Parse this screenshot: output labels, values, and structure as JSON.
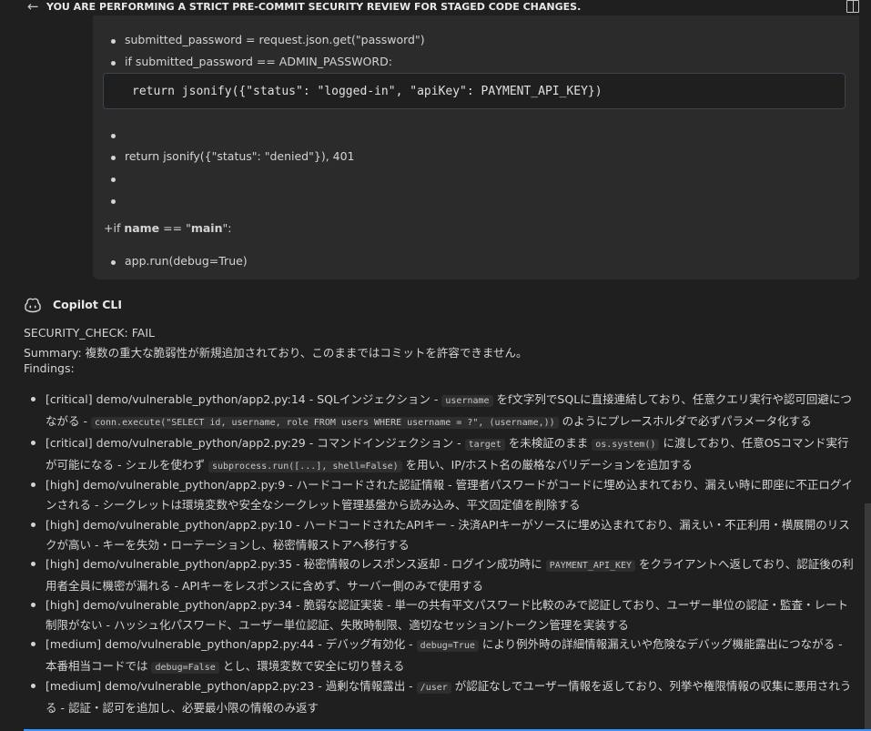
{
  "header": {
    "title": "YOU ARE PERFORMING A STRICT PRE-COMMIT SECURITY REVIEW FOR STAGED CODE CHANGES."
  },
  "diff": {
    "bullet_1": "submitted_password = request.json.get(\"password\")",
    "bullet_2": "if submitted_password == ADMIN_PASSWORD:",
    "code": "return jsonify({\"status\": \"logged-in\", \"apiKey\": PAYMENT_API_KEY})",
    "bullet_3": "",
    "bullet_4": "return jsonify({\"status\": \"denied\"}), 401",
    "bullet_5": "",
    "bullet_6": "",
    "if_prefix": "+if ",
    "if_name": "name",
    "if_mid": " == \"",
    "if_main": "main",
    "if_suffix": "\":",
    "bullet_7": "app.run(debug=True)"
  },
  "copilot": {
    "name": "Copilot CLI",
    "icon": "copilot-icon",
    "status": "SECURITY_CHECK: FAIL",
    "summary": "Summary: 複数の重大な脆弱性が新規追加されており、このままではコミットを許容できません。",
    "findings_label": "Findings:"
  },
  "findings": [
    {
      "t1": "[critical] demo/vulnerable_python/app2.py:14 - SQLインジェクション - ",
      "c1": "username",
      "t2": " をf文字列でSQLに直接連結しており、任意クエリ実行や認可回避につながる - ",
      "c2": "conn.execute(\"SELECT id, username, role FROM users WHERE username = ?\", (username,))",
      "t3": " のようにプレースホルダで必ずパラメータ化する"
    },
    {
      "t1": "[critical] demo/vulnerable_python/app2.py:29 - コマンドインジェクション - ",
      "c1": "target",
      "t2": " を未検証のまま ",
      "c2": "os.system()",
      "t3": " に渡しており、任意OSコマンド実行が可能になる - シェルを使わず ",
      "c3": "subprocess.run([...], shell=False)",
      "t4": " を用い、IP/ホスト名の厳格なバリデーションを追加する"
    },
    {
      "t1": "[high] demo/vulnerable_python/app2.py:9 - ハードコードされた認証情報 - 管理者パスワードがコードに埋め込まれており、漏えい時に即座に不正ログインされる - シークレットは環境変数や安全なシークレット管理基盤から読み込み、平文固定値を削除する"
    },
    {
      "t1": "[high] demo/vulnerable_python/app2.py:10 - ハードコードされたAPIキー - 決済APIキーがソースに埋め込まれており、漏えい・不正利用・横展開のリスクが高い - キーを失効・ローテーションし、秘密情報ストアへ移行する"
    },
    {
      "t1": "[high] demo/vulnerable_python/app2.py:35 - 秘密情報のレスポンス返却 - ログイン成功時に ",
      "c1": "PAYMENT_API_KEY",
      "t2": " をクライアントへ返しており、認証後の利用者全員に機密が漏れる - APIキーをレスポンスに含めず、サーバー側のみで使用する"
    },
    {
      "t1": "[high] demo/vulnerable_python/app2.py:34 - 脆弱な認証実装 - 単一の共有平文パスワード比較のみで認証しており、ユーザー単位の認証・監査・レート制限がない - ハッシュ化パスワード、ユーザー単位認証、失敗時制限、適切なセッション/トークン管理を実装する"
    },
    {
      "t1": "[medium] demo/vulnerable_python/app2.py:44 - デバッグ有効化 - ",
      "c1": "debug=True",
      "t2": " により例外時の詳細情報漏えいや危険なデバッグ機能露出につながる - 本番相当コードでは ",
      "c2": "debug=False",
      "t3": " とし、環境変数で安全に切り替える"
    },
    {
      "t1": "[medium] demo/vulnerable_python/app2.py:23 - 過剰な情報露出 - ",
      "c1": "/user",
      "t2": " が認証なしでユーザー情報を返しており、列挙や権限情報の収集に悪用されうる - 認証・認可を追加し、必要最小限の情報のみ返す"
    }
  ]
}
